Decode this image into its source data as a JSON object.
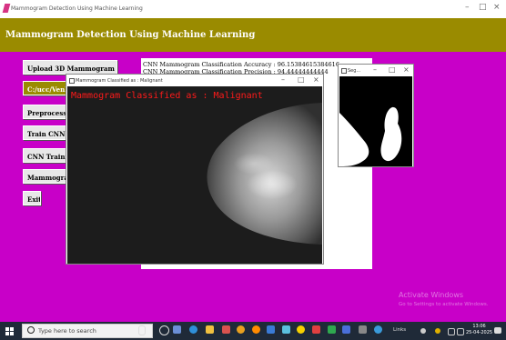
{
  "window": {
    "title": "Mammogram Detection Using Machine Learning",
    "controls": [
      "–",
      "□",
      "×"
    ]
  },
  "banner": {
    "title": "Mammogram Detection Using Machine Learning"
  },
  "buttons": {
    "upload": "Upload 3D Mammogram Dataset",
    "path": "C:/ucc/Venkat",
    "preprocess": "Preprocess Da",
    "train": "Train CNN Al",
    "training": "CNN Training",
    "mammogram": "Mammogram",
    "exit": "Exit"
  },
  "output": {
    "line1": "CNN Mammogram Classification Accuracy  : 96.15384615384616",
    "line2": "CNN Mammogram Classification Precision : 94.44444444444"
  },
  "result_window": {
    "title": "Mammogram Classified as : Malignant",
    "result_text": "Mammogram Classified as : Malignant",
    "controls": [
      "–",
      "□",
      "×"
    ]
  },
  "seg_window": {
    "title": "Seg...",
    "controls": [
      "–",
      "□",
      "×"
    ]
  },
  "activation": {
    "title": "Activate Windows",
    "subtitle": "Go to Settings to activate Windows."
  },
  "taskbar": {
    "search_placeholder": "Type here to search",
    "tray_text": "Links",
    "time": "13:06",
    "date": "25-04-2025"
  }
}
